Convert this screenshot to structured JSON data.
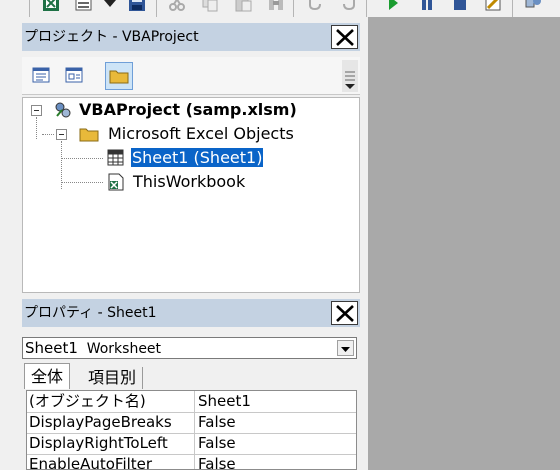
{
  "toolbar": {
    "icons": [
      "excel-icon",
      "insert-icon",
      "dropdown-arrow-icon",
      "save-icon",
      "cut-icon",
      "copy-icon",
      "paste-icon",
      "find-icon",
      "undo-icon",
      "redo-icon",
      "run-icon",
      "break-icon",
      "reset-icon",
      "design-mode-icon",
      "project-explorer-icon"
    ]
  },
  "project_explorer": {
    "title": "プロジェクト - VBAProject",
    "tools": [
      "view-code",
      "view-object",
      "toggle-folders"
    ],
    "tree": {
      "project": "VBAProject (samp.xlsm)",
      "folder": "Microsoft Excel Objects",
      "items": [
        "Sheet1 (Sheet1)",
        "ThisWorkbook"
      ]
    }
  },
  "properties": {
    "title": "プロパティ - Sheet1",
    "object_name": "Sheet1",
    "object_type": "Worksheet",
    "tabs": [
      "全体",
      "項目別"
    ],
    "rows": [
      {
        "name": "(オブジェクト名)",
        "value": "Sheet1"
      },
      {
        "name": "DisplayPageBreaks",
        "value": "False"
      },
      {
        "name": "DisplayRightToLeft",
        "value": "False"
      },
      {
        "name": "EnableAutoFilter",
        "value": "False"
      }
    ]
  },
  "colors": {
    "titlebar": "#c4d2e2",
    "selection": "#0a64c8",
    "workspace": "#a9a9a9"
  }
}
